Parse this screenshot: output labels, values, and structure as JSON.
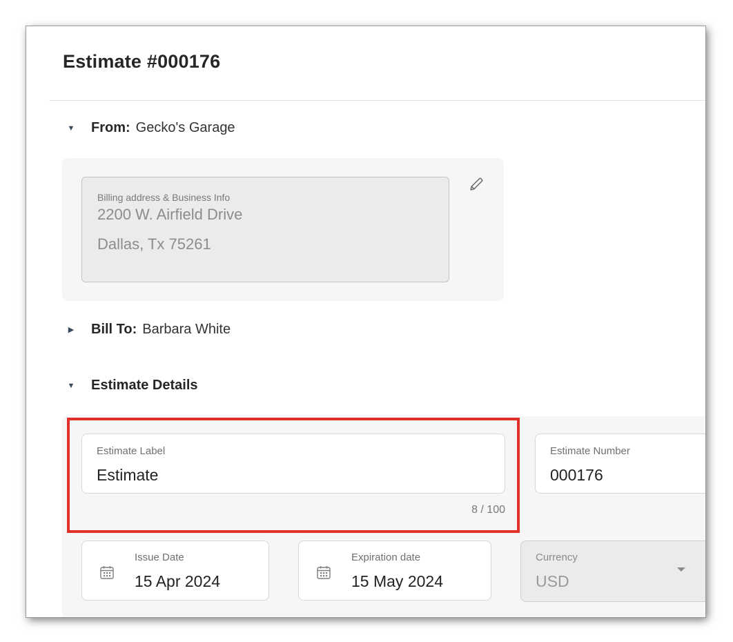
{
  "header": {
    "title": "Estimate #000176"
  },
  "from_section": {
    "label": "From:",
    "value": "Gecko's Garage",
    "billing": {
      "caption": "Billing address & Business Info",
      "line1": "2200 W. Airfield Drive",
      "line2": "Dallas, Tx 75261"
    }
  },
  "bill_to_section": {
    "label": "Bill To:",
    "value": "Barbara White"
  },
  "details_section": {
    "label": "Estimate Details",
    "estimate_label": {
      "caption": "Estimate Label",
      "value": "Estimate",
      "counter": "8 / 100"
    },
    "estimate_number": {
      "caption": "Estimate Number",
      "value": "000176"
    },
    "issue_date": {
      "caption": "Issue Date",
      "value": "15 Apr 2024"
    },
    "expiration_date": {
      "caption": "Expiration date",
      "value": "15 May 2024"
    },
    "currency": {
      "caption": "Currency",
      "value": "USD"
    }
  },
  "colors": {
    "highlight": "#e0302a",
    "panel": "#f6f6f6",
    "disabled": "#ebebeb"
  },
  "icons": {
    "edit": "pencil-icon",
    "calendar": "calendar-icon",
    "expanded": "caret-down-icon",
    "collapsed": "caret-right-icon",
    "dropdown": "dropdown-arrow-icon"
  }
}
